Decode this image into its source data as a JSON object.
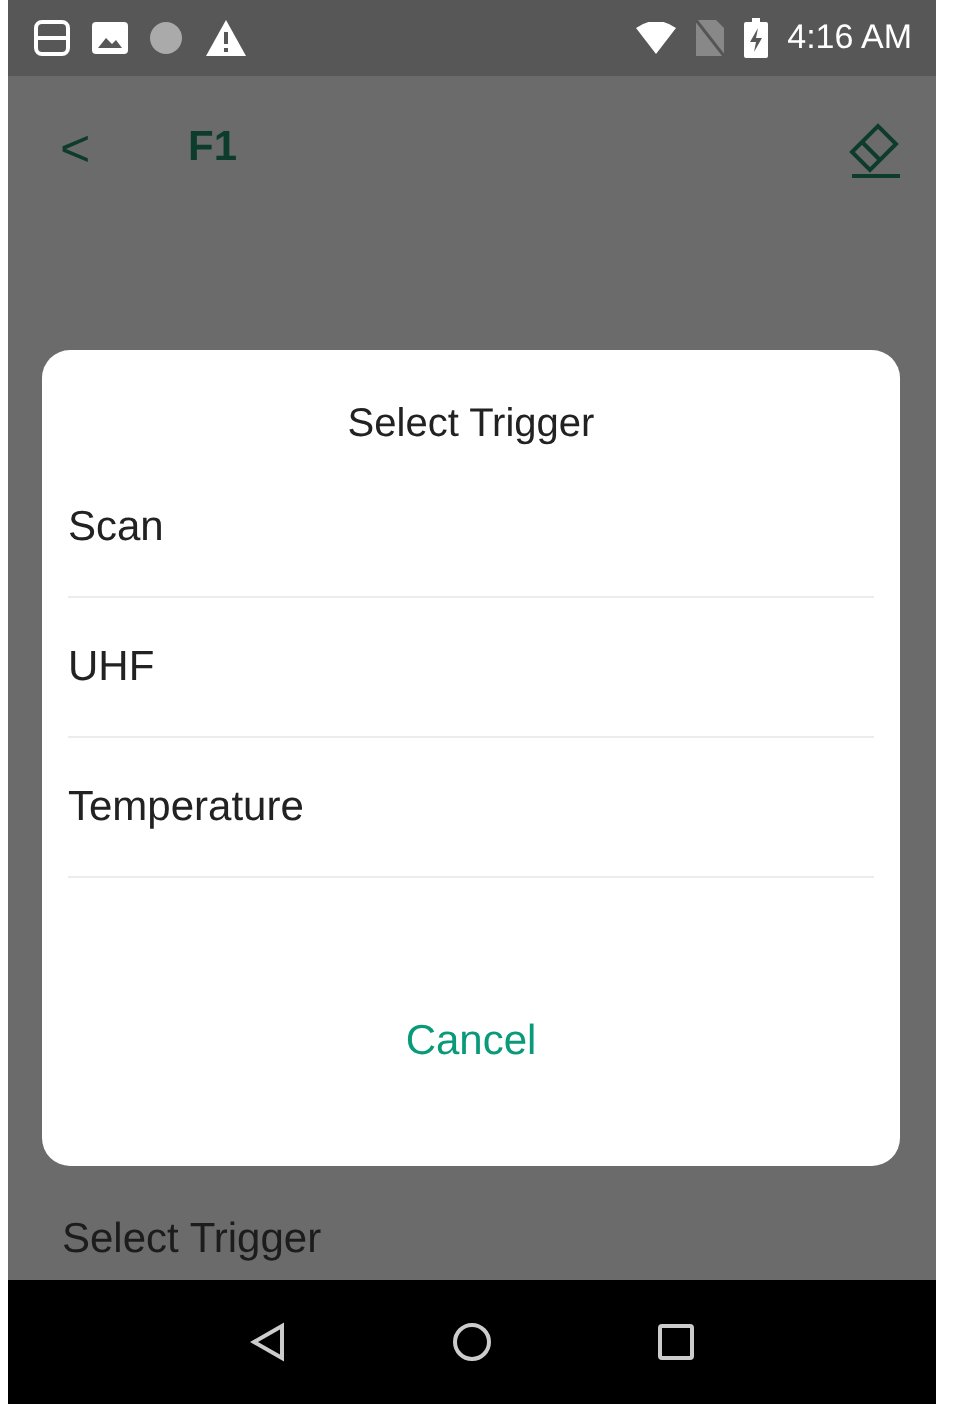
{
  "status_bar": {
    "time": "4:16 AM"
  },
  "toolbar": {
    "back": "<",
    "title": "F1"
  },
  "page": {
    "setting_label": "Select Trigger"
  },
  "dialog": {
    "title": "Select Trigger",
    "options": [
      {
        "label": "Scan"
      },
      {
        "label": "UHF"
      },
      {
        "label": "Temperature"
      }
    ],
    "cancel": "Cancel"
  }
}
